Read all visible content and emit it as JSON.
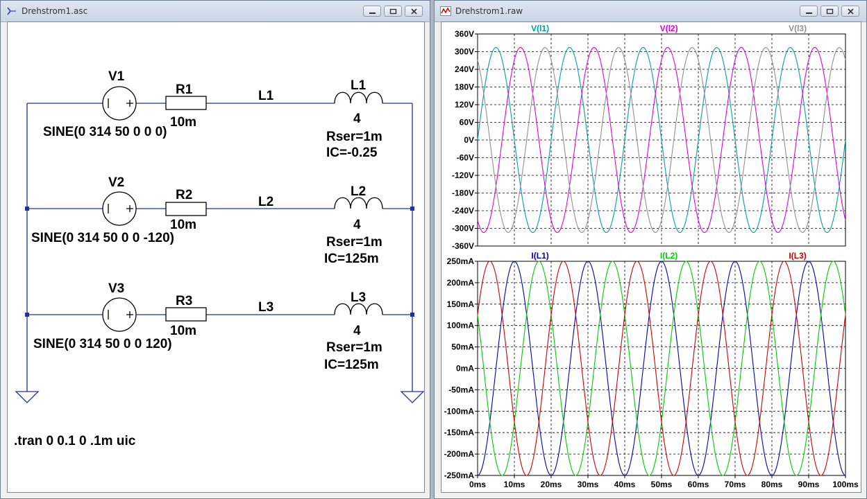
{
  "schematic_window": {
    "title": "Drehstrom1.asc",
    "components": {
      "v1": {
        "name": "V1",
        "value": "SINE(0 314 50 0 0 0)"
      },
      "v2": {
        "name": "V2",
        "value": "SINE(0 314 50 0 0 -120)"
      },
      "v3": {
        "name": "V3",
        "value": "SINE(0 314 50 0 0 120)"
      },
      "r1": {
        "name": "R1",
        "value": "10m"
      },
      "r2": {
        "name": "R2",
        "value": "10m"
      },
      "r3": {
        "name": "R3",
        "value": "10m"
      },
      "l1": {
        "name": "L1",
        "value": "4",
        "rser": "Rser=1m",
        "ic": "IC=-0.25"
      },
      "l2": {
        "name": "L2",
        "value": "4",
        "rser": "Rser=1m",
        "ic": "IC=125m"
      },
      "l3": {
        "name": "L3",
        "value": "4",
        "rser": "Rser=1m",
        "ic": "IC=125m"
      }
    },
    "net_labels": {
      "n1": "L1",
      "n2": "L2",
      "n3": "L3"
    },
    "directive": ".tran 0 0.1 0 .1m uic"
  },
  "waveform_window": {
    "title": "Drehstrom1.raw"
  },
  "chart_data": [
    {
      "type": "line",
      "title": "",
      "xlim": [
        0,
        100
      ],
      "ylim": [
        -360,
        360
      ],
      "yticks": [
        "360V",
        "300V",
        "240V",
        "180V",
        "120V",
        "60V",
        "0V",
        "-60V",
        "-120V",
        "-180V",
        "-240V",
        "-300V",
        "-360V"
      ],
      "grid": true,
      "legend": "top",
      "series": [
        {
          "name": "V(l1)",
          "color": "#00a0a0",
          "amplitude": 314,
          "freq_hz": 50,
          "phase_deg": 0
        },
        {
          "name": "V(l2)",
          "color": "#e000e0",
          "amplitude": 314,
          "freq_hz": 50,
          "phase_deg": -120
        },
        {
          "name": "V(l3)",
          "color": "#909090",
          "amplitude": 314,
          "freq_hz": 50,
          "phase_deg": 120
        }
      ]
    },
    {
      "type": "line",
      "title": "",
      "xlim": [
        0,
        100
      ],
      "ylim": [
        -250,
        250
      ],
      "xticks": [
        "0ms",
        "10ms",
        "20ms",
        "30ms",
        "40ms",
        "50ms",
        "60ms",
        "70ms",
        "80ms",
        "90ms",
        "100ms"
      ],
      "yticks": [
        "250mA",
        "200mA",
        "150mA",
        "100mA",
        "50mA",
        "0mA",
        "-50mA",
        "-100mA",
        "-150mA",
        "-200mA",
        "-250mA"
      ],
      "grid": true,
      "legend": "top",
      "series": [
        {
          "name": "I(L1)",
          "color": "#0000b0",
          "amplitude": 250,
          "freq_hz": 50,
          "phase_deg": -90
        },
        {
          "name": "I(L2)",
          "color": "#00cc00",
          "amplitude": 250,
          "freq_hz": 50,
          "phase_deg": -210
        },
        {
          "name": "I(L3)",
          "color": "#cc0000",
          "amplitude": 250,
          "freq_hz": 50,
          "phase_deg": 30
        }
      ]
    }
  ]
}
